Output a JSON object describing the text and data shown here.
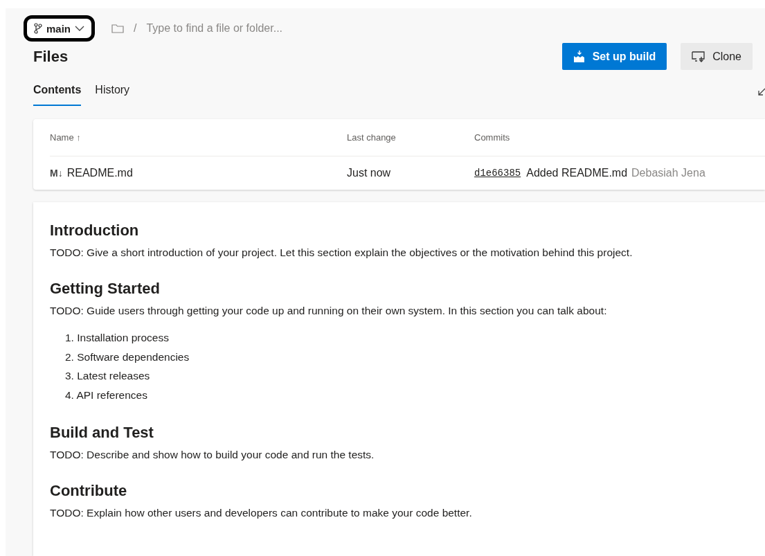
{
  "breadcrumb": {
    "branch": "main",
    "separator": "/",
    "placeholder": "Type to find a file or folder..."
  },
  "title": "Files",
  "buttons": [
    {
      "label": "Set up build",
      "kind": "primary"
    },
    {
      "label": "Clone",
      "kind": "secondary"
    }
  ],
  "tabs": [
    {
      "label": "Contents",
      "selected": true
    },
    {
      "label": "History",
      "selected": false
    }
  ],
  "table": {
    "columns": [
      "Name ↑",
      "Last change",
      "Commits"
    ],
    "rows": [
      {
        "icon": "M↓",
        "name": "README.md",
        "last_change": "Just now",
        "commit_id": "d1e66385",
        "commit_message": "Added README.md",
        "author": "Debasiah Jena"
      }
    ]
  },
  "readme": [
    {
      "kind": "heading",
      "text": "Introduction"
    },
    {
      "kind": "paragraph",
      "text": "TODO: Give a short introduction of your project. Let this section explain the objectives or the motivation behind this project."
    },
    {
      "kind": "heading",
      "text": "Getting Started"
    },
    {
      "kind": "paragraph",
      "text": "TODO: Guide users through getting your code up and running on their own system. In this section you can talk about:"
    },
    {
      "kind": "list",
      "items": [
        "1. Installation process",
        "2. Software dependencies",
        "3. Latest releases",
        "4. API references"
      ]
    },
    {
      "kind": "heading",
      "text": "Build and Test"
    },
    {
      "kind": "paragraph",
      "text": "TODO: Describe and show how to build your code and run the tests."
    },
    {
      "kind": "heading",
      "text": "Contribute"
    },
    {
      "kind": "paragraph",
      "text": "TODO: Explain how other users and developers can contribute to make your code better."
    }
  ]
}
